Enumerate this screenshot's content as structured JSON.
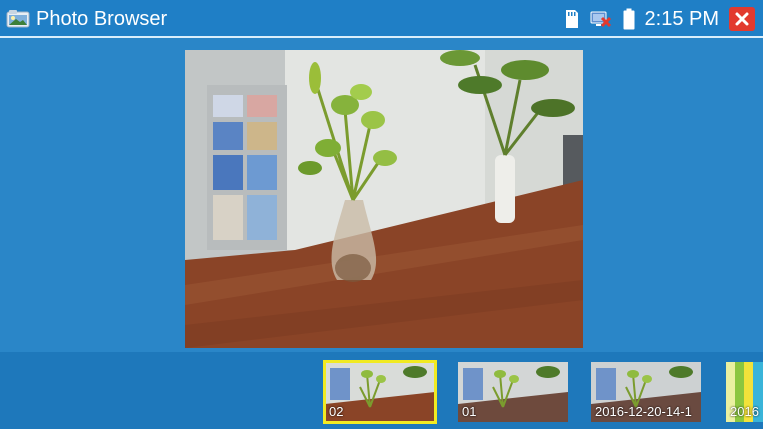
{
  "header": {
    "title": "Photo Browser",
    "time": "2:15 PM"
  },
  "icons": {
    "app": "photo-folder-icon",
    "sd_card": "sd-card-icon",
    "network": "network-disconnected-icon",
    "battery": "battery-icon",
    "close": "close-icon"
  },
  "colors": {
    "background": "#2a86c8",
    "titlebar": "#1f7fc6",
    "selection": "#f1ea22",
    "close": "#e23a2f"
  },
  "thumbnails": [
    {
      "label": "02",
      "selected": true
    },
    {
      "label": "01",
      "selected": false
    },
    {
      "label": "2016-12-20-14-1",
      "selected": false
    },
    {
      "label": "2016",
      "selected": false
    }
  ]
}
